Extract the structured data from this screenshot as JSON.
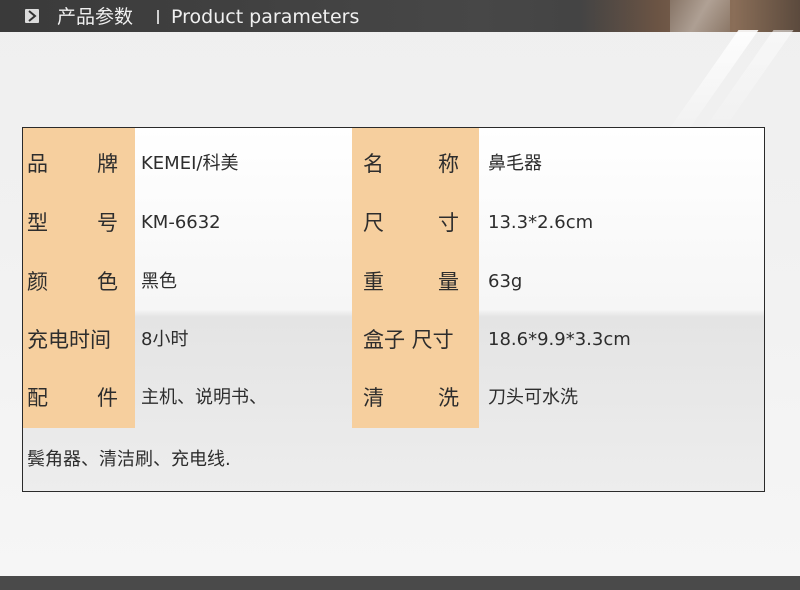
{
  "header": {
    "title_cn": "产品参数",
    "title_en": "Product parameters"
  },
  "table": {
    "rows": [
      {
        "label_l": [
          "品",
          "牌"
        ],
        "value_l": "KEMEI/科美",
        "label_r": [
          "名",
          "称"
        ],
        "value_r": "鼻毛器"
      },
      {
        "label_l": [
          "型",
          "号"
        ],
        "value_l": "KM-6632",
        "label_r": [
          "尺",
          "寸"
        ],
        "value_r": "13.3*2.6cm"
      },
      {
        "label_l": [
          "颜",
          "色"
        ],
        "value_l": "黑色",
        "label_r": [
          "重",
          "量"
        ],
        "value_r": " 63g"
      },
      {
        "label_l": [
          "充电时间"
        ],
        "value_l": "8小时",
        "label_r": [
          "盒子 尺寸"
        ],
        "value_r": "18.6*9.9*3.3cm"
      },
      {
        "label_l": [
          "配",
          "件"
        ],
        "value_l": "主机、说明书、",
        "label_r": [
          "清",
          "洗"
        ],
        "value_r": "刀头可水洗"
      }
    ],
    "footer_text": "鬓角器、清洁刷、充电线."
  },
  "colors": {
    "label_bg": "#f6cf9e",
    "header_bg": "#404040",
    "text": "#2d2d2d"
  }
}
